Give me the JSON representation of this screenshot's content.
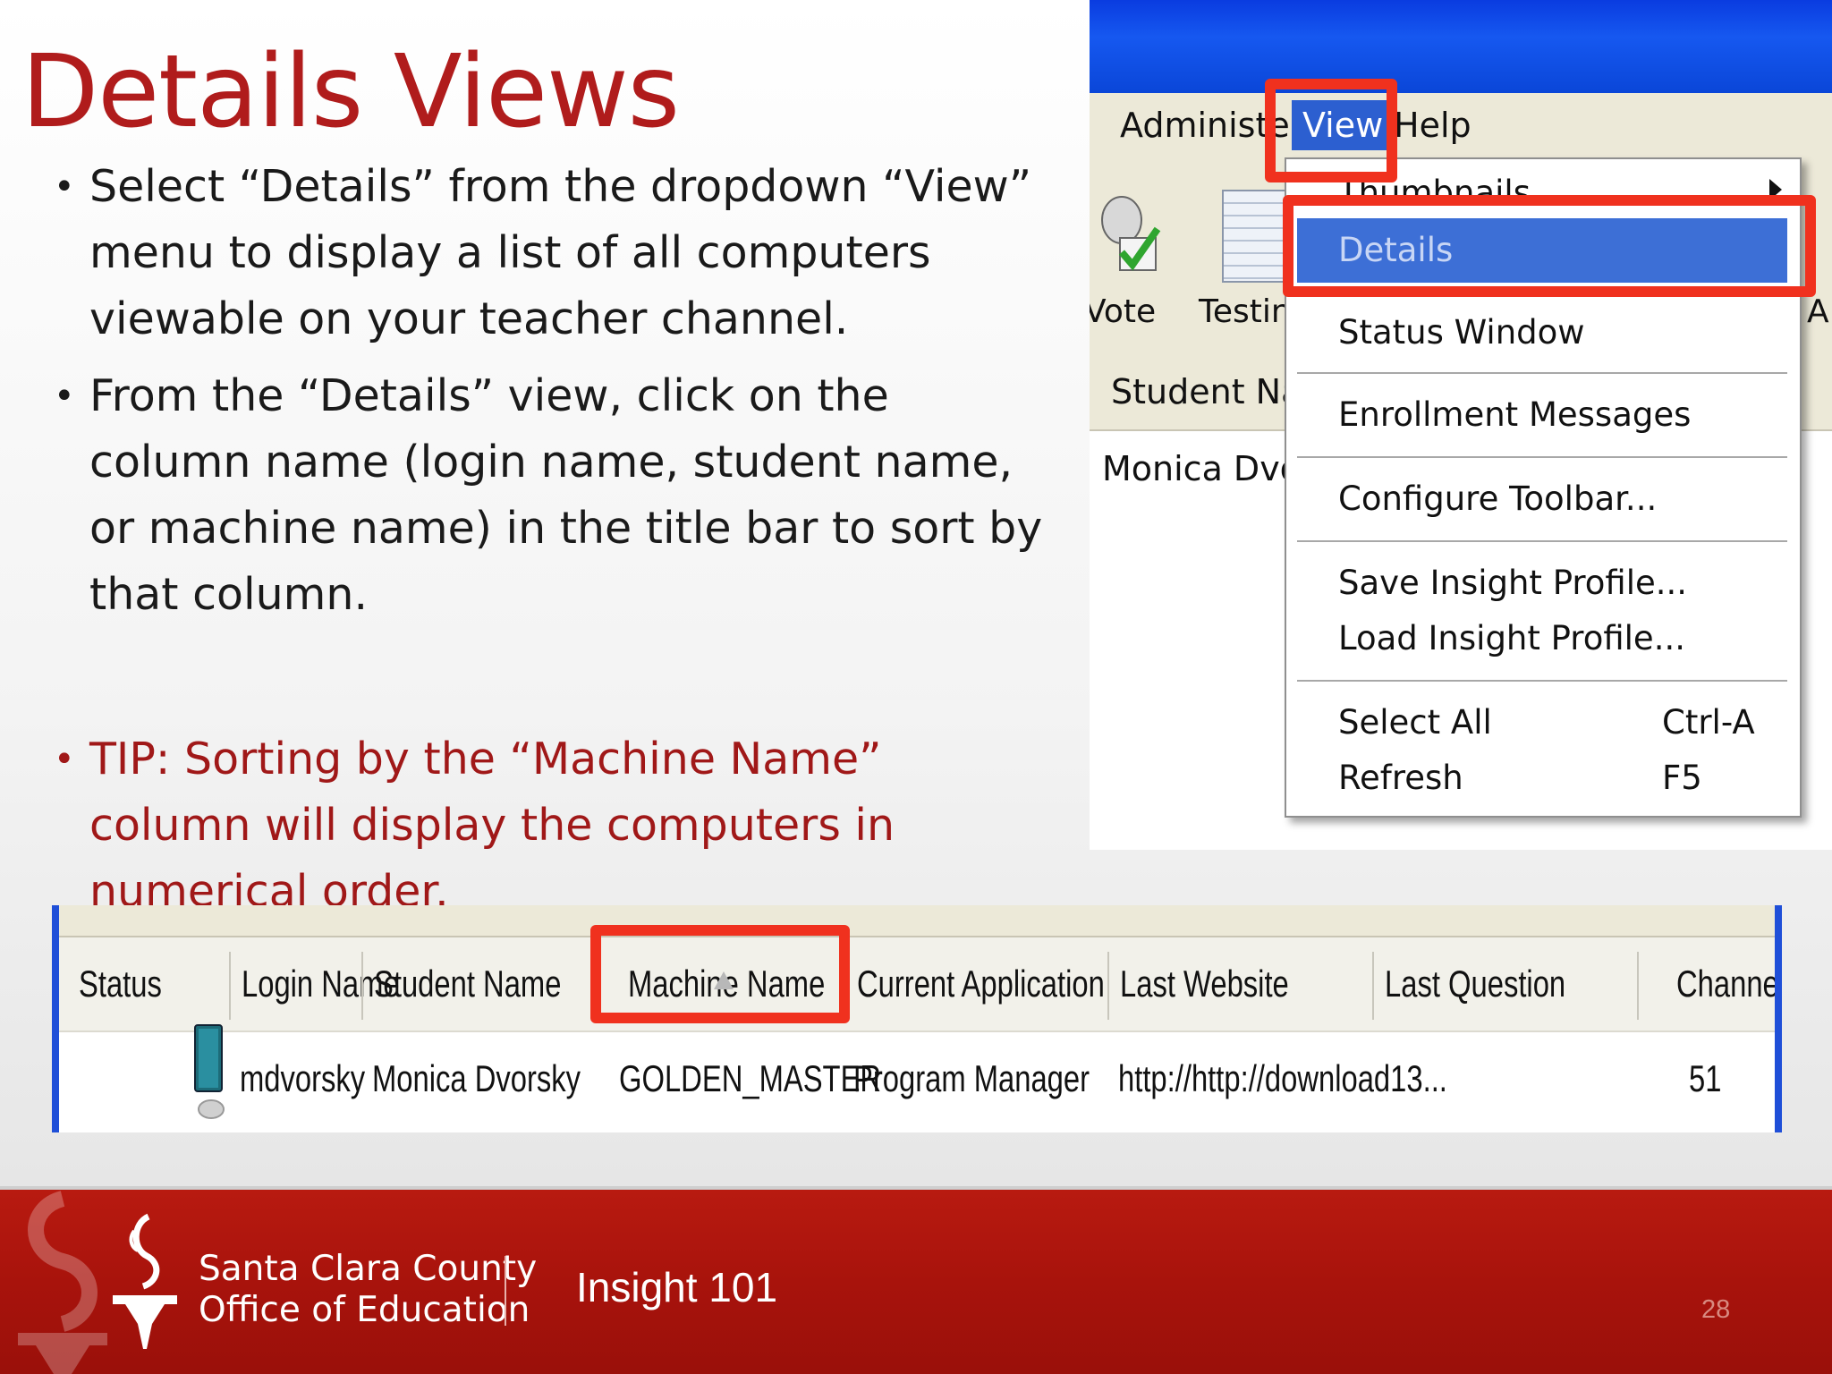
{
  "slide": {
    "title": "Details Views",
    "bullets": [
      "Select “Details” from the dropdown “View” menu to display a list of all computers viewable on your teacher channel.",
      "From the “Details” view, click on the column name (login name, student name, or machine name) in the title bar to sort by that column.",
      "TIP:  Sorting by the “Machine Name” column will display the computers in numerical order."
    ]
  },
  "menu_screenshot": {
    "menubar": {
      "administer": "Administer",
      "view": "View",
      "help": "Help"
    },
    "toolbar_labels": {
      "vote": "Vote",
      "testing": "Testin",
      "all": "All"
    },
    "column_header": "Student Nam",
    "list_row": "Monica Dvors",
    "dropdown": {
      "thumbnails": "Thumbnails",
      "details": "Details",
      "status_window": "Status Window",
      "enrollment_messages": "Enrollment Messages",
      "configure_toolbar": "Configure Toolbar...",
      "save_profile": "Save Insight Profile...",
      "load_profile": "Load Insight Profile...",
      "select_all": "Select All",
      "select_all_shortcut": "Ctrl-A",
      "refresh": "Refresh",
      "refresh_shortcut": "F5"
    }
  },
  "details_table": {
    "columns": [
      "Status",
      "Login Name",
      "Student Name",
      "Machine Name",
      "Current Application",
      "Last Website",
      "Last Question",
      "Channel"
    ],
    "sorted_column": "Machine Name",
    "row": {
      "login": "mdvorsky",
      "student": "Monica Dvorsky",
      "machine": "GOLDEN_MASTER",
      "application": "Program Manager",
      "website": "http://http://download13...",
      "channel": "51"
    }
  },
  "footer": {
    "org_line1": "Santa Clara County",
    "org_line2": "Office of Education",
    "course": "Insight 101",
    "page": "28"
  },
  "colors": {
    "title": "#b01c1c",
    "tip": "#a01818",
    "footer": "#aa140c",
    "highlight": "#f0311e",
    "selection": "#3d6fd6"
  }
}
